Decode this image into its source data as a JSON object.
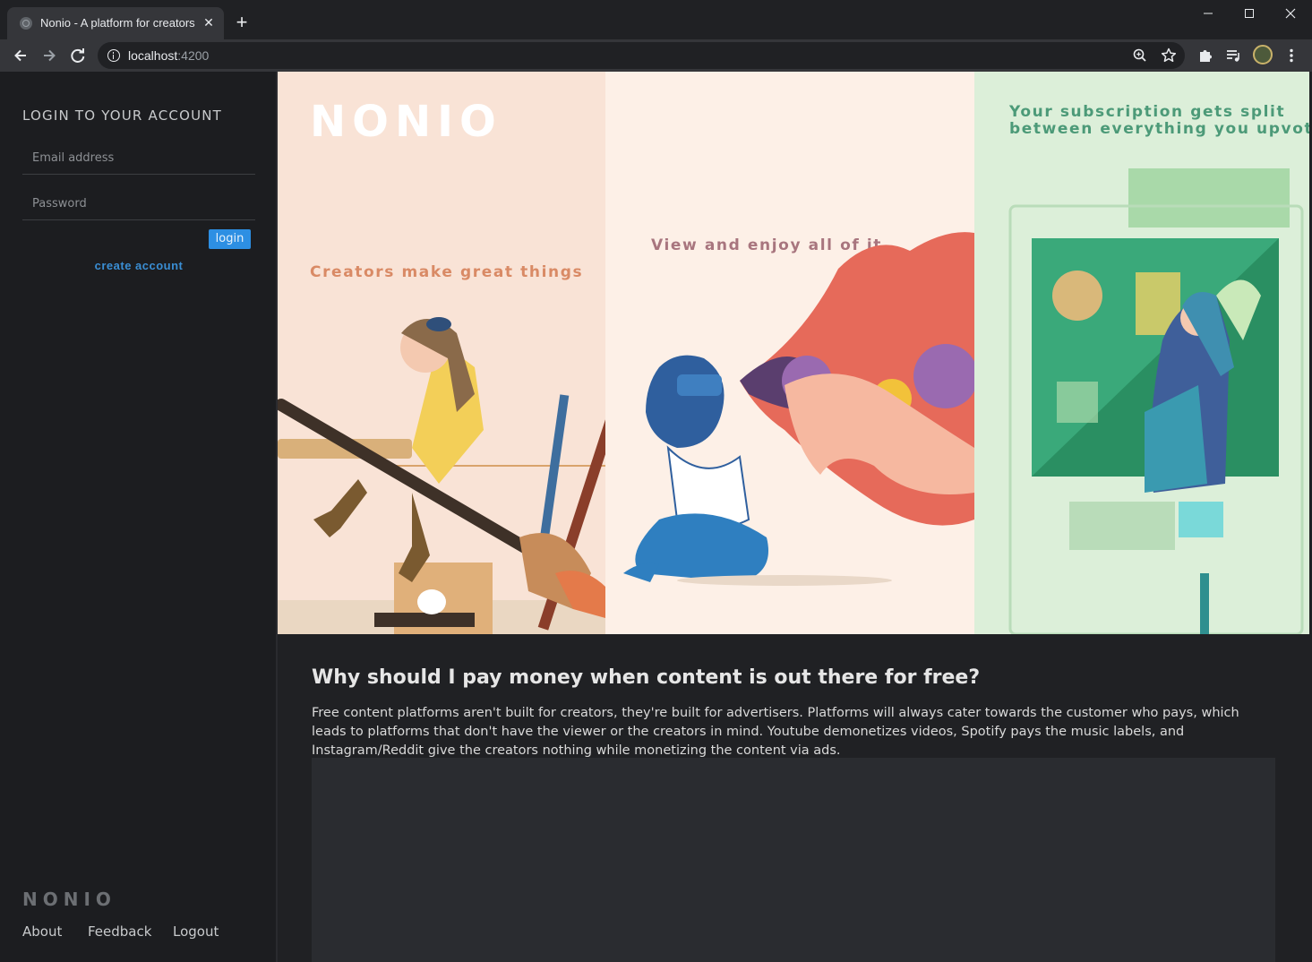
{
  "browser": {
    "tab_title": "Nonio - A platform for creators",
    "url_host": "localhost",
    "url_port": ":4200"
  },
  "sidebar": {
    "heading": "LOGIN TO YOUR ACCOUNT",
    "email_placeholder": "Email address",
    "password_placeholder": "Password",
    "login_label": "login",
    "create_account_label": "create account",
    "logo": "NONIO",
    "footer_links": [
      "About",
      "Feedback",
      "Logout"
    ]
  },
  "hero": {
    "logo": "NONIO",
    "caption_1": "Creators make great things",
    "caption_2": "View and enjoy all of it",
    "caption_3_line1": "Your subscription gets split",
    "caption_3_line2": "between everything you upvote"
  },
  "content": {
    "title": "Why should I pay money when content is out there for free?",
    "body": "Free content platforms aren't built for creators, they're built for advertisers. Platforms will always cater towards the customer who pays, which leads to platforms that don't have the viewer or the creators in mind. Youtube demonetizes videos, Spotify pays the music labels, and Instagram/Reddit give the creators nothing while monetizing the content via ads."
  },
  "icons": {
    "back": "arrow-left-icon",
    "forward": "arrow-right-icon",
    "reload": "reload-icon",
    "zoom": "zoom-icon",
    "bookmark": "star-icon",
    "extensions": "puzzle-icon",
    "media": "media-control-icon",
    "menu": "kebab-menu-icon"
  },
  "colors": {
    "accent": "#2d8fe3",
    "link": "#3a8ed4",
    "sidebar_bg": "#1c1d20",
    "main_bg": "#202124"
  }
}
